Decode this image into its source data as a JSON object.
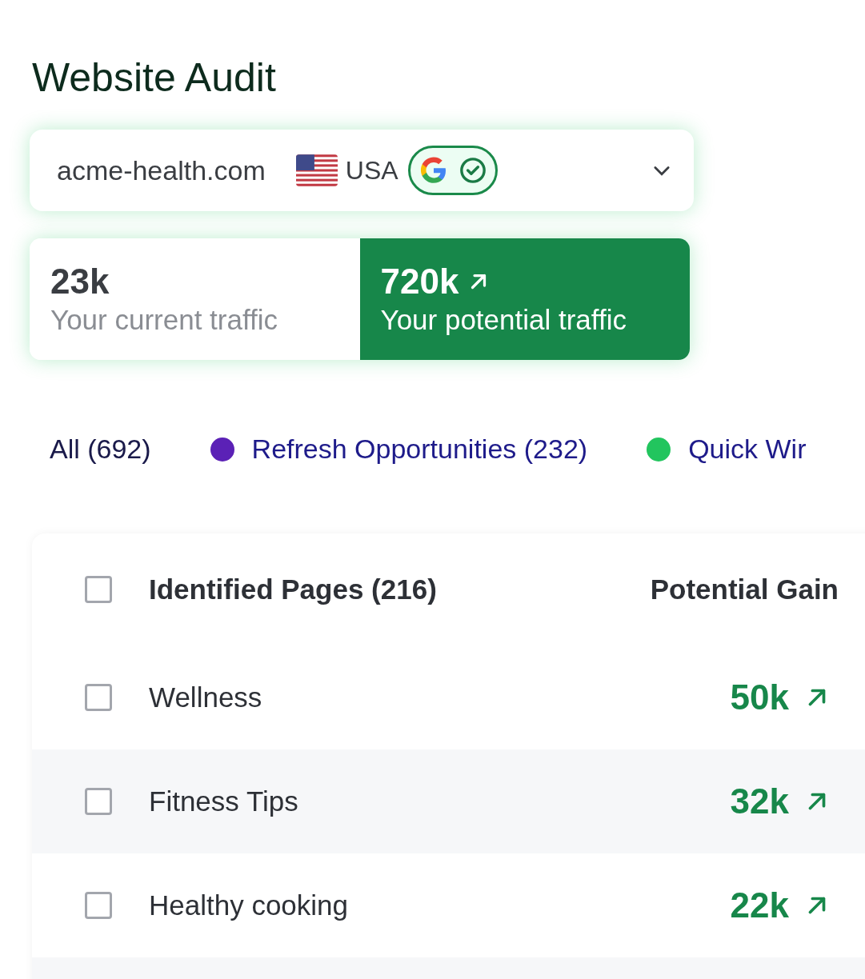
{
  "title": "Website Audit",
  "site": {
    "domain": "acme-health.com",
    "country": "USA",
    "verified": true
  },
  "traffic": [
    {
      "value": "23k",
      "label": "Your current traffic",
      "selected": false
    },
    {
      "value": "720k",
      "label": "Your potential traffic",
      "selected": true
    }
  ],
  "filters": [
    {
      "label": "All (692)"
    },
    {
      "label": "Refresh Opportunities (232)",
      "color": "#5b21b6"
    },
    {
      "label": "Quick Wir",
      "color": "#22c55e"
    }
  ],
  "table": {
    "select_all_checked": false,
    "columns": [
      "Identified Pages (216)",
      "Potential Gain"
    ],
    "rows": [
      {
        "page": "Wellness",
        "gain": "50k",
        "checked": false
      },
      {
        "page": "Fitness Tips",
        "gain": "32k",
        "checked": false
      },
      {
        "page": "Healthy cooking",
        "gain": "22k",
        "checked": false
      }
    ]
  }
}
